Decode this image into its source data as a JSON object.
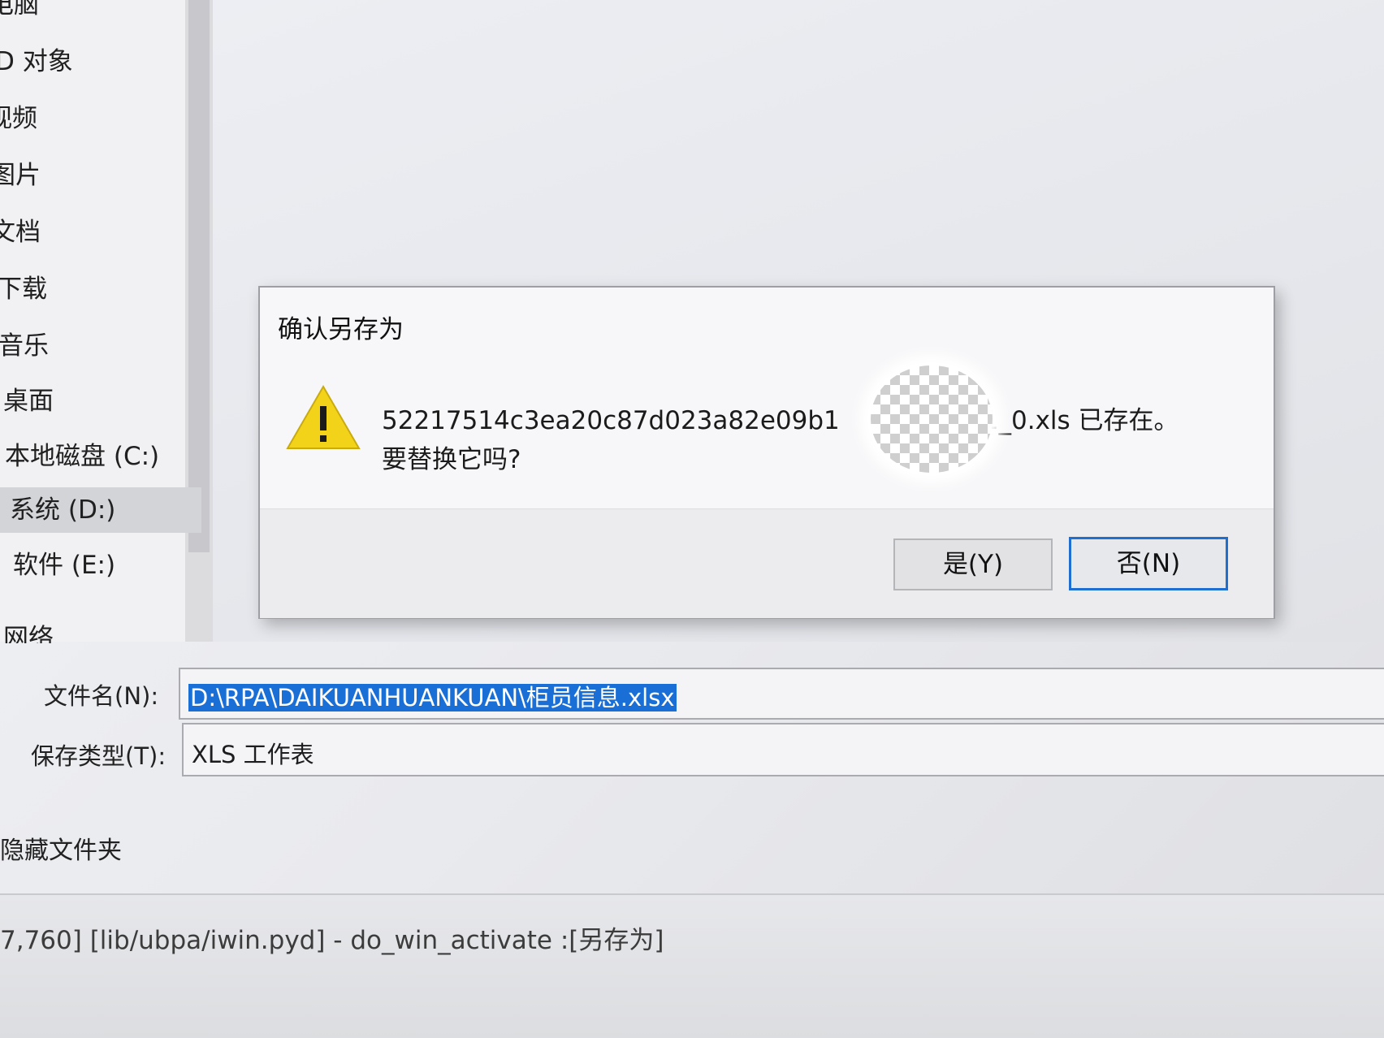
{
  "nav": {
    "items": [
      {
        "label": "电脑"
      },
      {
        "label": "D 对象"
      },
      {
        "label": "视频"
      },
      {
        "label": "图片"
      },
      {
        "label": "文档"
      },
      {
        "label": "下载"
      },
      {
        "label": "音乐"
      },
      {
        "label": "桌面"
      },
      {
        "label": "本地磁盘 (C:)"
      },
      {
        "label": "系统 (D:)"
      },
      {
        "label": "软件 (E:)"
      },
      {
        "label": "网络"
      }
    ],
    "selected_index": 9,
    "scroll_down_glyph": "⌄"
  },
  "form": {
    "filename_label": "文件名(N):",
    "filename_value": "D:\\RPA\\DAIKUANHUANKUAN\\柜员信息.xlsx",
    "filetype_label": "保存类型(T):",
    "filetype_value": "XLS 工作表",
    "hide_folders_label": "隐藏文件夹"
  },
  "dialog": {
    "title": "确认另存为",
    "message_prefix": "52217514c3ea20c87d023a82e09b1",
    "message_suffix": "1_0.xls 已存在。",
    "message_line2": "要替换它吗?",
    "yes_label": "是(Y)",
    "no_label": "否(N)",
    "icon": "warning-icon"
  },
  "console": {
    "log_line": "7,760] [lib/ubpa/iwin.pyd] - do_win_activate :[另存为]"
  },
  "colors": {
    "selection": "#1a6fd6",
    "warning_yellow": "#f2d31a",
    "default_button_border": "#1f6fd0"
  }
}
